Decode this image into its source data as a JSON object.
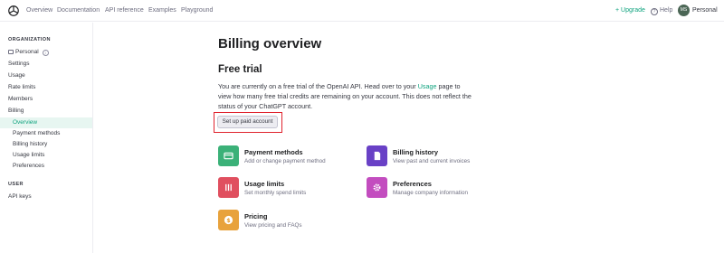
{
  "topnav": {
    "links": [
      "Overview",
      "Documentation",
      "API reference",
      "Examples",
      "Playground"
    ],
    "upgrade": "Upgrade",
    "help": "Help",
    "account": "Personal",
    "avatar_initials": "MS"
  },
  "sidebar": {
    "org_heading": "ORGANIZATION",
    "org_name": "Personal",
    "items": [
      "Settings",
      "Usage",
      "Rate limits",
      "Members",
      "Billing"
    ],
    "billing_subitems": [
      "Overview",
      "Payment methods",
      "Billing history",
      "Usage limits",
      "Preferences"
    ],
    "active_subitem": "Overview",
    "user_heading": "USER",
    "user_items": [
      "API keys"
    ]
  },
  "main": {
    "title": "Billing overview",
    "section_title": "Free trial",
    "paragraph_before_link": "You are currently on a free trial of the OpenAI API. Head over to your ",
    "paragraph_link": "Usage",
    "paragraph_after_link": " page to view how many free trial credits are remaining on your account. This does not reflect the status of your ChatGPT account.",
    "cta_button": "Set up paid account",
    "cards": [
      {
        "title": "Payment methods",
        "desc": "Add or change payment method",
        "icon": "credit-card-icon",
        "color": "#3bb178"
      },
      {
        "title": "Billing history",
        "desc": "View past and current invoices",
        "icon": "document-icon",
        "color": "#6941c6"
      },
      {
        "title": "Usage limits",
        "desc": "Set monthly spend limits",
        "icon": "sliders-icon",
        "color": "#e04f5f"
      },
      {
        "title": "Preferences",
        "desc": "Manage company information",
        "icon": "gear-icon",
        "color": "#c34dbf"
      },
      {
        "title": "Pricing",
        "desc": "View pricing and FAQs",
        "icon": "dollar-icon",
        "color": "#e8a23c"
      }
    ]
  },
  "colors": {
    "accent": "#10a37f",
    "highlight": "#e0232e",
    "active_bg": "#e7f6f1"
  }
}
